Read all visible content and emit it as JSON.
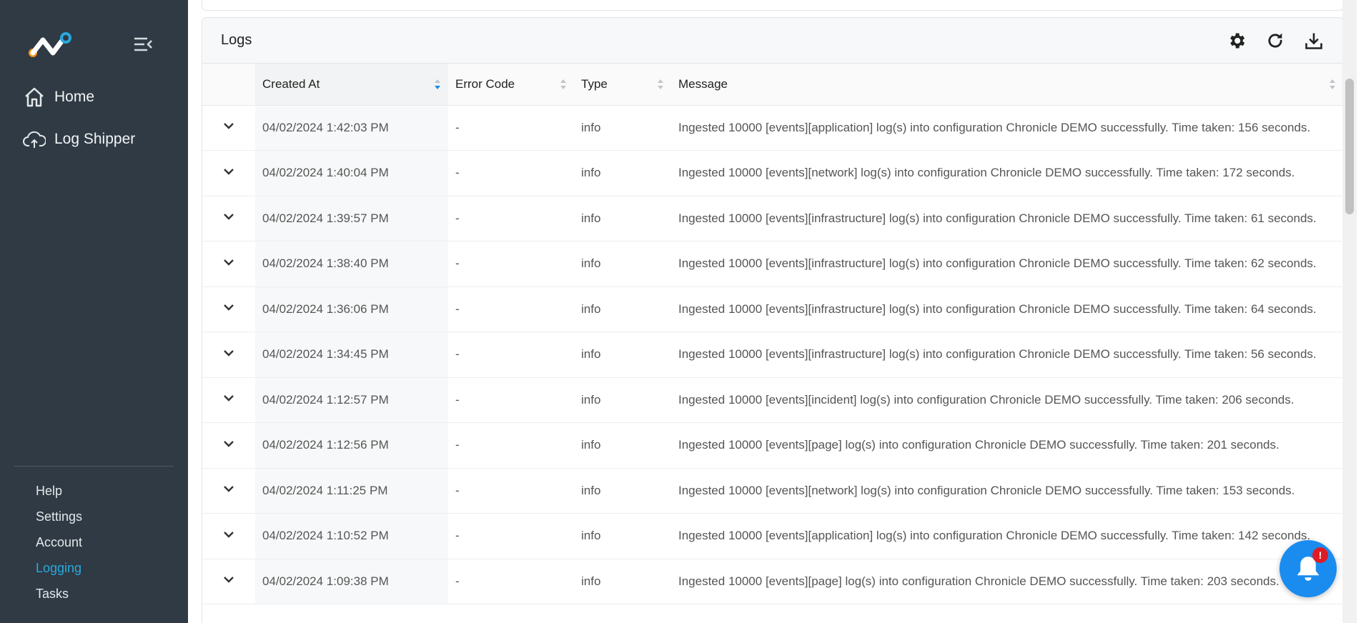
{
  "colors": {
    "sidebar_bg": "#2f3a44",
    "active_link": "#29a8e0",
    "fab": "#1a8cf0",
    "badge": "#e01b24",
    "logo_orange": "#f7941d",
    "logo_blue": "#29a8e0"
  },
  "sidebar": {
    "nav": [
      {
        "label": "Home",
        "icon": "home-icon"
      },
      {
        "label": "Log Shipper",
        "icon": "cloud-upload-icon"
      }
    ],
    "bottom_links": [
      {
        "label": "Help",
        "active": false
      },
      {
        "label": "Settings",
        "active": false
      },
      {
        "label": "Account",
        "active": false
      },
      {
        "label": "Logging",
        "active": true
      },
      {
        "label": "Tasks",
        "active": false
      }
    ]
  },
  "logs": {
    "title": "Logs",
    "toolbar_icons": [
      "gear-icon",
      "refresh-icon",
      "download-icon"
    ],
    "columns": [
      "Created At",
      "Error Code",
      "Type",
      "Message"
    ],
    "rows": [
      {
        "created": "04/02/2024 1:42:03 PM",
        "code": "-",
        "type": "info",
        "message": "Ingested 10000 [events][application] log(s) into configuration Chronicle DEMO successfully. Time taken: 156 seconds."
      },
      {
        "created": "04/02/2024 1:40:04 PM",
        "code": "-",
        "type": "info",
        "message": "Ingested 10000 [events][network] log(s) into configuration Chronicle DEMO successfully. Time taken: 172 seconds."
      },
      {
        "created": "04/02/2024 1:39:57 PM",
        "code": "-",
        "type": "info",
        "message": "Ingested 10000 [events][infrastructure] log(s) into configuration Chronicle DEMO successfully. Time taken: 61 seconds."
      },
      {
        "created": "04/02/2024 1:38:40 PM",
        "code": "-",
        "type": "info",
        "message": "Ingested 10000 [events][infrastructure] log(s) into configuration Chronicle DEMO successfully. Time taken: 62 seconds."
      },
      {
        "created": "04/02/2024 1:36:06 PM",
        "code": "-",
        "type": "info",
        "message": "Ingested 10000 [events][infrastructure] log(s) into configuration Chronicle DEMO successfully. Time taken: 64 seconds."
      },
      {
        "created": "04/02/2024 1:34:45 PM",
        "code": "-",
        "type": "info",
        "message": "Ingested 10000 [events][infrastructure] log(s) into configuration Chronicle DEMO successfully. Time taken: 56 seconds."
      },
      {
        "created": "04/02/2024 1:12:57 PM",
        "code": "-",
        "type": "info",
        "message": "Ingested 10000 [events][incident] log(s) into configuration Chronicle DEMO successfully. Time taken: 206 seconds."
      },
      {
        "created": "04/02/2024 1:12:56 PM",
        "code": "-",
        "type": "info",
        "message": "Ingested 10000 [events][page] log(s) into configuration Chronicle DEMO successfully. Time taken: 201 seconds."
      },
      {
        "created": "04/02/2024 1:11:25 PM",
        "code": "-",
        "type": "info",
        "message": "Ingested 10000 [events][network] log(s) into configuration Chronicle DEMO successfully. Time taken: 153 seconds."
      },
      {
        "created": "04/02/2024 1:10:52 PM",
        "code": "-",
        "type": "info",
        "message": "Ingested 10000 [events][application] log(s) into configuration Chronicle DEMO successfully. Time taken: 142 seconds."
      },
      {
        "created": "04/02/2024 1:09:38 PM",
        "code": "-",
        "type": "info",
        "message": "Ingested 10000 [events][page] log(s) into configuration Chronicle DEMO successfully. Time taken: 203 seconds."
      }
    ]
  },
  "notification": {
    "badge": "!"
  }
}
